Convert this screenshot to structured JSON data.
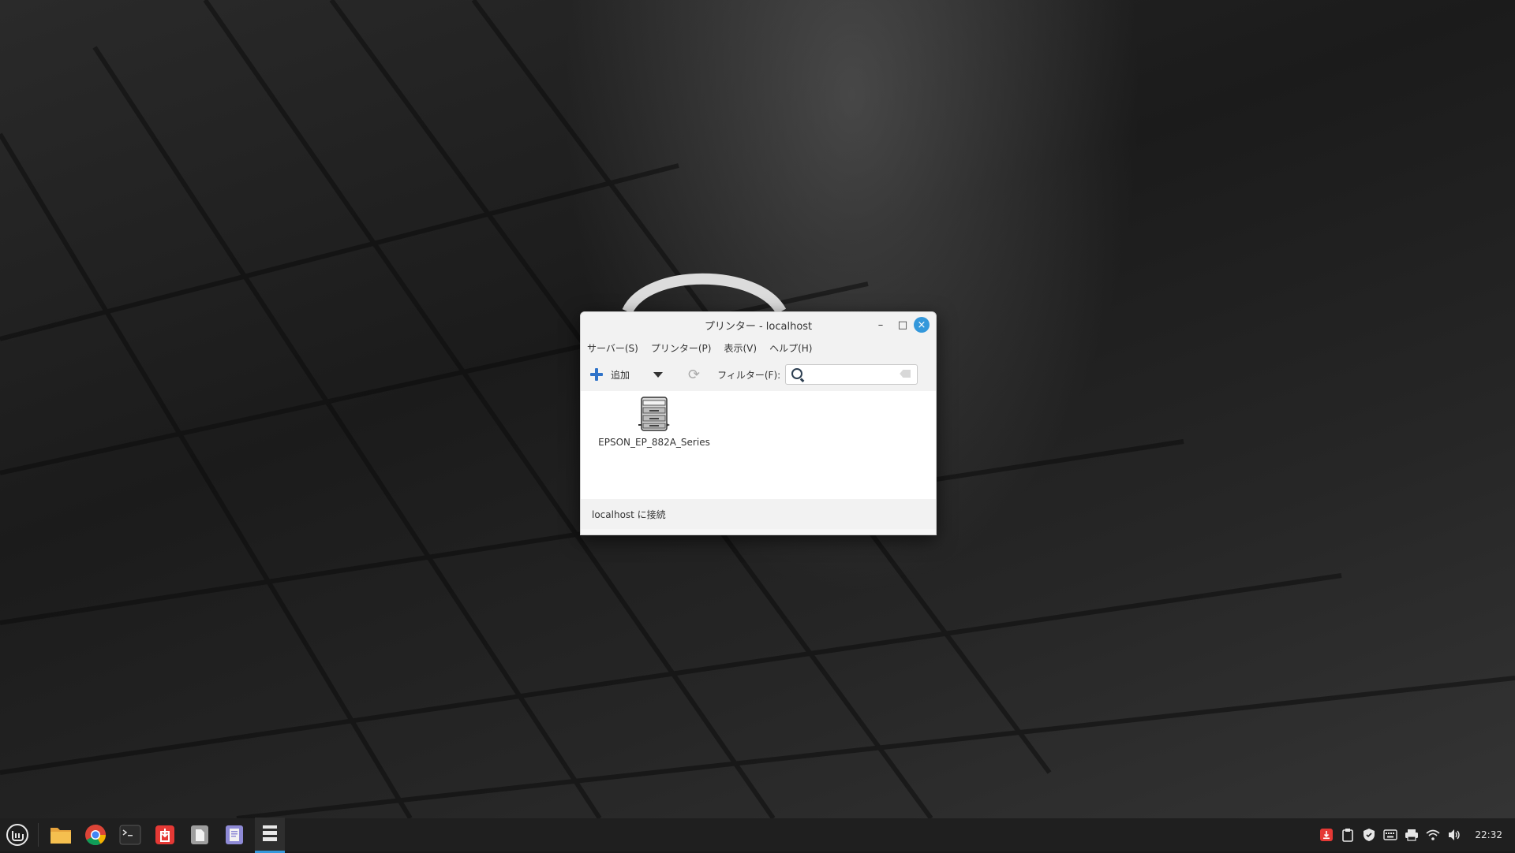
{
  "window": {
    "title": "プリンター - localhost",
    "minimize_glyph": "–",
    "maximize_glyph": "□",
    "close_glyph": "×"
  },
  "menubar": {
    "items": [
      {
        "label": "サーバー(S)"
      },
      {
        "label": "プリンター(P)"
      },
      {
        "label": "表示(V)"
      },
      {
        "label": "ヘルプ(H)"
      }
    ]
  },
  "toolbar": {
    "add_label": "追加",
    "filter_label": "フィルター(F):",
    "filter_value": "",
    "refresh_glyph": "⟳"
  },
  "printers": [
    {
      "name": "EPSON_EP_882A_Series"
    }
  ],
  "statusbar": {
    "text": "localhost に接続"
  },
  "taskbar": {
    "clock": "22:32",
    "launchers": [
      "menu-icon",
      "files-icon",
      "chrome-icon",
      "terminal-icon",
      "update-manager-icon",
      "text-editor-icon",
      "document-viewer-icon",
      "printers-icon"
    ],
    "tray": [
      "update-manager-tray-icon",
      "clipboard-icon",
      "shield-icon",
      "keyboard-icon",
      "printer-tray-icon",
      "wifi-icon",
      "volume-icon"
    ]
  },
  "colors": {
    "accent": "#3498db",
    "add_icon": "#2f73c9",
    "taskbar": "#1f1f1f",
    "update_red": "#e53935"
  }
}
